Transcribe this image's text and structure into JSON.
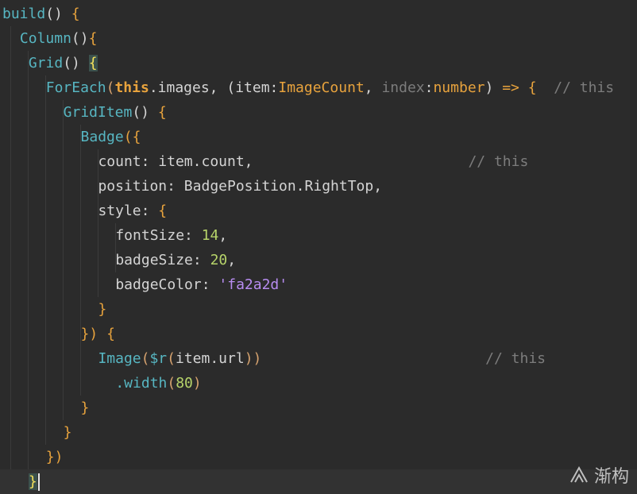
{
  "editor": {
    "lines": [
      {
        "indent": 0,
        "tokens": [
          {
            "t": "build",
            "c": "c-func"
          },
          {
            "t": "() ",
            "c": "c-plain"
          },
          {
            "t": "{",
            "c": "c-brace"
          }
        ]
      },
      {
        "indent": 1,
        "tokens": [
          {
            "t": "Column",
            "c": "c-func"
          },
          {
            "t": "()",
            "c": "c-plain"
          },
          {
            "t": "{",
            "c": "c-brace"
          }
        ]
      },
      {
        "indent": 1.5,
        "tokens": [
          {
            "t": "Grid",
            "c": "c-func"
          },
          {
            "t": "() ",
            "c": "c-plain"
          },
          {
            "t": "{",
            "c": "c-brace-hl"
          }
        ]
      },
      {
        "indent": 2.5,
        "tokens": [
          {
            "t": "ForEach",
            "c": "c-func"
          },
          {
            "t": "(",
            "c": "c-paren"
          },
          {
            "t": "this",
            "c": "c-kw"
          },
          {
            "t": ".images, (",
            "c": "c-plain"
          },
          {
            "t": "item:",
            "c": "c-plain"
          },
          {
            "t": "ImageCount",
            "c": "c-type"
          },
          {
            "t": ", ",
            "c": "c-plain"
          },
          {
            "t": "index",
            "c": "c-hint"
          },
          {
            "t": ":",
            "c": "c-plain"
          },
          {
            "t": "number",
            "c": "c-type"
          },
          {
            "t": ") ",
            "c": "c-plain"
          },
          {
            "t": "=>",
            "c": "c-op"
          },
          {
            "t": " {  ",
            "c": "c-brace"
          },
          {
            "t": "// this",
            "c": "c-comment"
          }
        ]
      },
      {
        "indent": 3.5,
        "tokens": [
          {
            "t": "GridItem",
            "c": "c-func"
          },
          {
            "t": "() ",
            "c": "c-plain"
          },
          {
            "t": "{",
            "c": "c-brace"
          }
        ]
      },
      {
        "indent": 4.5,
        "tokens": [
          {
            "t": "Badge",
            "c": "c-func"
          },
          {
            "t": "({",
            "c": "c-brace"
          }
        ]
      },
      {
        "indent": 5.5,
        "tokens": [
          {
            "t": "count: item.count,",
            "c": "c-prop"
          },
          {
            "t": "                         ",
            "c": "c-plain"
          },
          {
            "t": "// this",
            "c": "c-comment"
          }
        ]
      },
      {
        "indent": 5.5,
        "tokens": [
          {
            "t": "position: BadgePosition.RightTop,",
            "c": "c-prop"
          }
        ]
      },
      {
        "indent": 5.5,
        "tokens": [
          {
            "t": "style: ",
            "c": "c-prop"
          },
          {
            "t": "{",
            "c": "c-brace"
          }
        ]
      },
      {
        "indent": 6.5,
        "tokens": [
          {
            "t": "fontSize: ",
            "c": "c-prop"
          },
          {
            "t": "14",
            "c": "c-num"
          },
          {
            "t": ",",
            "c": "c-plain"
          }
        ]
      },
      {
        "indent": 6.5,
        "tokens": [
          {
            "t": "badgeSize: ",
            "c": "c-prop"
          },
          {
            "t": "20",
            "c": "c-num"
          },
          {
            "t": ",",
            "c": "c-plain"
          }
        ]
      },
      {
        "indent": 6.5,
        "tokens": [
          {
            "t": "badgeColor: ",
            "c": "c-prop"
          },
          {
            "t": "'fa2a2d'",
            "c": "c-str"
          }
        ]
      },
      {
        "indent": 5.5,
        "tokens": [
          {
            "t": "}",
            "c": "c-brace"
          }
        ]
      },
      {
        "indent": 4.5,
        "tokens": [
          {
            "t": "}) ",
            "c": "c-brace"
          },
          {
            "t": "{",
            "c": "c-brace"
          }
        ]
      },
      {
        "indent": 5.5,
        "tokens": [
          {
            "t": "Image",
            "c": "c-func"
          },
          {
            "t": "(",
            "c": "c-paren"
          },
          {
            "t": "$r",
            "c": "c-func"
          },
          {
            "t": "(",
            "c": "c-paren"
          },
          {
            "t": "item.url",
            "c": "c-plain"
          },
          {
            "t": "))",
            "c": "c-paren"
          },
          {
            "t": "                          ",
            "c": "c-plain"
          },
          {
            "t": "// this",
            "c": "c-comment"
          }
        ]
      },
      {
        "indent": 6.5,
        "tokens": [
          {
            "t": ".width",
            "c": "c-func"
          },
          {
            "t": "(",
            "c": "c-paren"
          },
          {
            "t": "80",
            "c": "c-num"
          },
          {
            "t": ")",
            "c": "c-paren"
          }
        ]
      },
      {
        "indent": 4.5,
        "tokens": [
          {
            "t": "}",
            "c": "c-brace"
          }
        ]
      },
      {
        "indent": 3.5,
        "tokens": [
          {
            "t": "}",
            "c": "c-brace"
          }
        ]
      },
      {
        "indent": 2.5,
        "tokens": [
          {
            "t": "})",
            "c": "c-brace"
          }
        ]
      },
      {
        "indent": 1.5,
        "tokens": [
          {
            "t": "}",
            "c": "c-brace-hl"
          }
        ],
        "current": true,
        "caret": true
      }
    ]
  },
  "watermark": {
    "text": "渐构",
    "logo_icon": "mountain-logo-icon"
  }
}
